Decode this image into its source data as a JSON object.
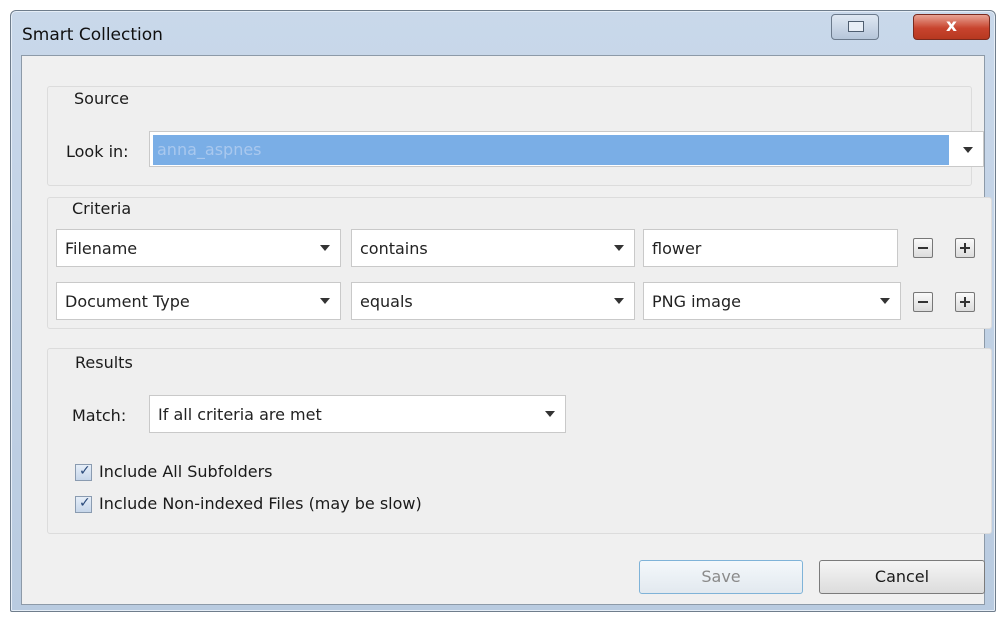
{
  "window": {
    "title": "Smart Collection"
  },
  "source": {
    "group_label": "Source",
    "look_in_label": "Look in:",
    "look_in_value": "anna_aspnes"
  },
  "criteria": {
    "group_label": "Criteria",
    "rows": [
      {
        "field": "Filename",
        "operator": "contains",
        "value": "flower",
        "value_is_dropdown": false
      },
      {
        "field": "Document Type",
        "operator": "equals",
        "value": "PNG image",
        "value_is_dropdown": true
      }
    ]
  },
  "results": {
    "group_label": "Results",
    "match_label": "Match:",
    "match_value": "If all criteria are met",
    "include_subfolders_label": "Include All Subfolders",
    "include_subfolders_checked": true,
    "include_nonindexed_label": "Include Non-indexed Files (may be slow)",
    "include_nonindexed_checked": true
  },
  "buttons": {
    "save": "Save",
    "cancel": "Cancel"
  }
}
